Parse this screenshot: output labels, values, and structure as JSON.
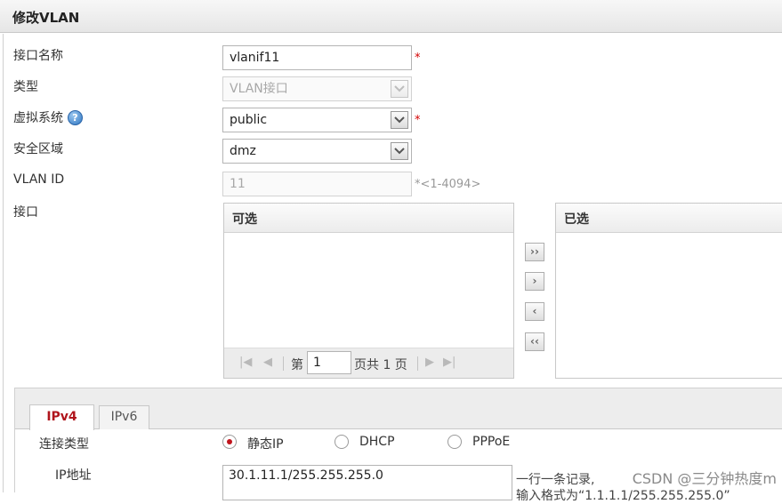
{
  "dialog": {
    "title": "修改VLAN"
  },
  "form": {
    "iface_name": {
      "label": "接口名称",
      "value": "vlanif11",
      "required": "*"
    },
    "type": {
      "label": "类型",
      "value": "VLAN接口"
    },
    "vsys": {
      "label": "虚拟系统",
      "help": "?",
      "value": "public",
      "required": "*"
    },
    "zone": {
      "label": "安全区域",
      "value": "dmz"
    },
    "vlan_id": {
      "label": "VLAN ID",
      "value": "11",
      "range_hint": "*<1-4094>"
    },
    "interface": {
      "label": "接口"
    }
  },
  "transfer": {
    "available_title": "可选",
    "selected_title": "已选",
    "pager": {
      "page_prefix": "第",
      "page": "1",
      "page_suffix": "页共 1 页"
    },
    "buttons": {
      "add_all": "››",
      "add": "›",
      "remove": "‹",
      "remove_all": "‹‹"
    }
  },
  "tabs": [
    {
      "label": "IPv4"
    },
    {
      "label": "IPv6"
    }
  ],
  "ipv4": {
    "conn_label": "连接类型",
    "options": [
      {
        "label": "静态IP"
      },
      {
        "label": "DHCP"
      },
      {
        "label": "PPPoE"
      }
    ],
    "selected": "静态IP",
    "ip_label": "IP地址",
    "ip_value": "30.1.11.1/255.255.255.0",
    "note_line1": "一行一条记录,",
    "note_line2": "输入格式为“1.1.1.1/255.255.255.0”"
  },
  "watermark": "CSDN @三分钟热度m",
  "colors": {
    "accent": "#b0151c",
    "required": "#d40000",
    "help": "#2f76c2"
  }
}
